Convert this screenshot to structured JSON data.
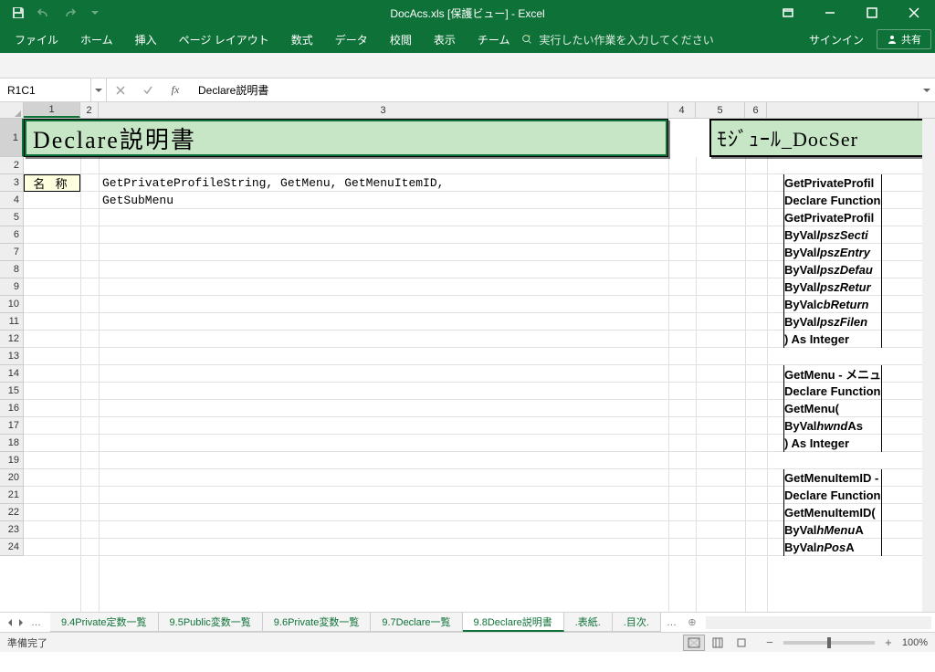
{
  "title": "DocAcs.xls  [保護ビュー] - Excel",
  "qat": {
    "save": "保存",
    "undo": "元に戻す",
    "redo": "やり直し"
  },
  "ribbon": {
    "tabs": [
      "ファイル",
      "ホーム",
      "挿入",
      "ページ レイアウト",
      "数式",
      "データ",
      "校閲",
      "表示",
      "チーム"
    ],
    "tellme": "実行したい作業を入力してください",
    "signin": "サインイン",
    "share": "共有"
  },
  "namebox": "R1C1",
  "formula": "Declare説明書",
  "colheads": [
    "1",
    "2",
    "3",
    "4",
    "5",
    "6",
    ""
  ],
  "rowcount": 24,
  "titles": {
    "left": "Declare説明書",
    "right": "ﾓｼﾞｭｰﾙ_DocSer"
  },
  "label_meisho": "名 称",
  "r3c3": "GetPrivateProfileString, GetMenu, GetMenuItemID,",
  "r4c3": "GetSubMenu",
  "code": {
    "block1": [
      "GetPrivateProfil",
      "Declare Function",
      "GetPrivateProfil",
      {
        "indent": "  ",
        "pre": "ByVal ",
        "it": "lpszSecti"
      },
      {
        "indent": "  ",
        "pre": "ByVal ",
        "it": "lpszEntry"
      },
      {
        "indent": "  ",
        "pre": "ByVal ",
        "it": "lpszDefau"
      },
      {
        "indent": "  ",
        "pre": "ByVal ",
        "it": "lpszRetur"
      },
      {
        "indent": "  ",
        "pre": "ByVal ",
        "it": "cbReturn "
      },
      {
        "indent": "  ",
        "pre": "ByVal ",
        "it": "lpszFilen"
      },
      ") As Integer"
    ],
    "block2": [
      "GetMenu - メニュ",
      "Declare Function",
      "GetMenu(",
      {
        "indent": "  ",
        "pre": "ByVal ",
        "it": "hwnd",
        "post": "  As"
      },
      ") As Integer"
    ],
    "block3": [
      "GetMenuItemID -",
      "Declare Function",
      "GetMenuItemID(",
      {
        "indent": "  ",
        "pre": "ByVal ",
        "it": "hMenu",
        "post": "  A"
      },
      {
        "indent": "  ",
        "pre": "ByVal ",
        "it": "nPos",
        "post": "   A"
      }
    ]
  },
  "sheets": [
    "9.4Private定数一覧",
    "9.5Public変数一覧",
    "9.6Private変数一覧",
    "9.7Declare一覧",
    "9.8Declare説明書",
    ".表紙.",
    ".目次."
  ],
  "active_sheet": 4,
  "status": "準備完了",
  "zoom": "100%"
}
